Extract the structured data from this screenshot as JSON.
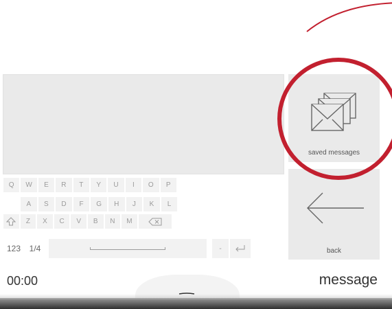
{
  "keyboard": {
    "row1": [
      "Q",
      "W",
      "E",
      "R",
      "T",
      "Y",
      "U",
      "I",
      "O",
      "P"
    ],
    "row2": [
      "A",
      "S",
      "D",
      "F",
      "G",
      "H",
      "J",
      "K",
      "L"
    ],
    "row3": [
      "Z",
      "X",
      "C",
      "V",
      "B",
      "N",
      "M"
    ],
    "row4": {
      "numbers_label": "123",
      "page_label": "1/4",
      "dash_label": "-"
    }
  },
  "tiles": {
    "saved_label": "saved messages",
    "back_label": "back"
  },
  "footer": {
    "time": "00:00",
    "title": "message"
  },
  "colors": {
    "highlight": "#c2202f",
    "tile_bg": "#eaeaea"
  }
}
